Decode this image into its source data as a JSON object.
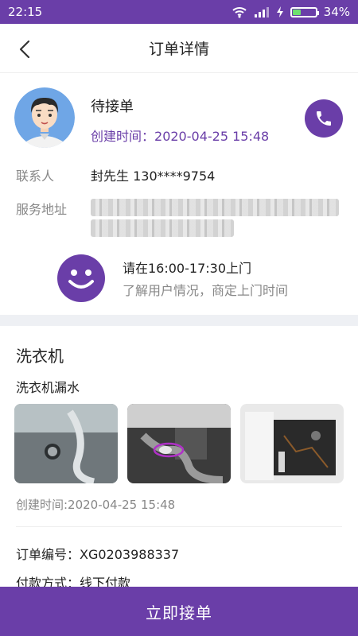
{
  "status_bar": {
    "time": "22:15",
    "battery": "34%",
    "battery_level": 0.34
  },
  "header": {
    "title": "订单详情"
  },
  "order": {
    "status": "待接单",
    "created_label": "创建时间：",
    "created_value": "2020-04-25 15:48",
    "contact_label": "联系人",
    "contact_value": "封先生   130****9754",
    "address_label": "服务地址",
    "visit_line1": "请在16:00-17:30上门",
    "visit_line2": "了解用户情况，商定上门时间"
  },
  "detail": {
    "appliance": "洗衣机",
    "problem": "洗衣机漏水",
    "photos": [
      "washer-drain-pipe-photo",
      "washer-hose-leak-photo",
      "washer-underside-photo"
    ],
    "created": "创建时间:2020-04-25 15:48",
    "order_no": "订单编号：XG0203988337",
    "payment": "付款方式：线下付款"
  },
  "footer": {
    "accept_label": "立即接单"
  },
  "colors": {
    "accent": "#6a3ea8"
  }
}
